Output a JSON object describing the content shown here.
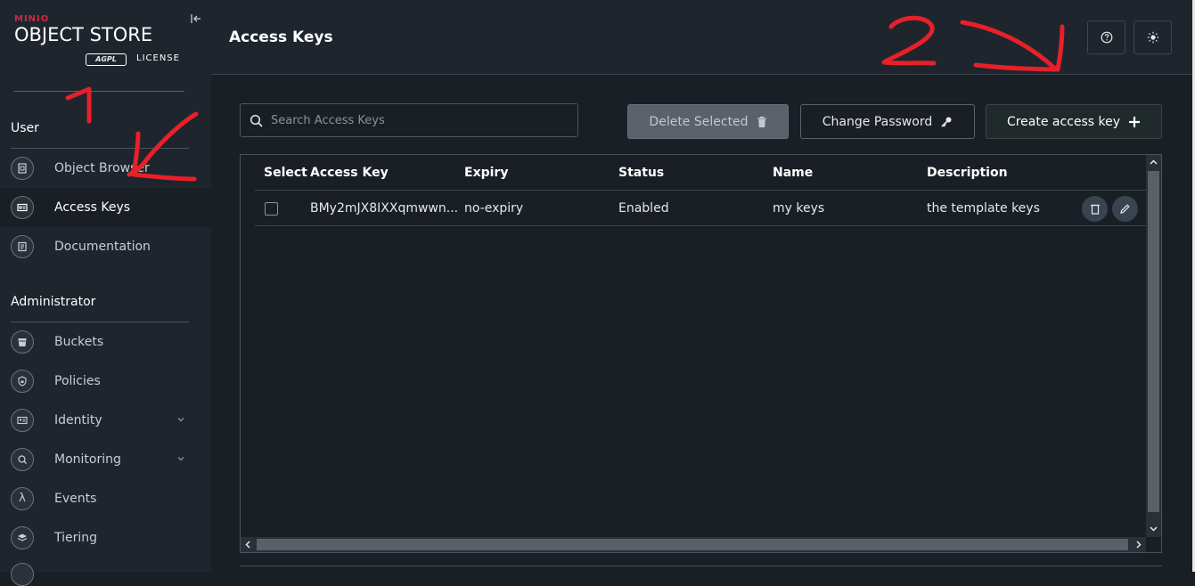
{
  "brand": {
    "minio": "MINIO",
    "product": "OBJECT STORE",
    "license_badge": "AGPL",
    "license": "LICENSE"
  },
  "sidebar": {
    "user_section": "User",
    "admin_section": "Administrator",
    "user_items": [
      {
        "label": "Object Browser",
        "icon": "object-browser-icon"
      },
      {
        "label": "Access Keys",
        "icon": "access-keys-icon",
        "active": true
      },
      {
        "label": "Documentation",
        "icon": "documentation-icon"
      }
    ],
    "admin_items": [
      {
        "label": "Buckets",
        "icon": "buckets-icon"
      },
      {
        "label": "Policies",
        "icon": "policies-icon"
      },
      {
        "label": "Identity",
        "icon": "identity-icon",
        "expandable": true
      },
      {
        "label": "Monitoring",
        "icon": "monitoring-icon",
        "expandable": true
      },
      {
        "label": "Events",
        "icon": "events-icon"
      },
      {
        "label": "Tiering",
        "icon": "tiering-icon"
      }
    ]
  },
  "header": {
    "title": "Access Keys"
  },
  "toolbar": {
    "search_placeholder": "Search Access Keys",
    "search_value": "",
    "delete_label": "Delete Selected",
    "change_password_label": "Change Password",
    "create_label": "Create access key"
  },
  "table": {
    "columns": [
      "Select",
      "Access Key",
      "Expiry",
      "Status",
      "Name",
      "Description"
    ],
    "rows": [
      {
        "access_key": "BMy2mJX8IXXqmwwn...",
        "expiry": "no-expiry",
        "status": "Enabled",
        "name": "my keys",
        "description": "the template keys",
        "selected": false
      }
    ]
  },
  "annotations": {
    "color": "#e8202a",
    "labels": [
      "1",
      "2"
    ]
  },
  "colors": {
    "sidebar_bg": "#1f252d",
    "content_bg": "#1a1f26",
    "accent_red": "#c72c48"
  }
}
